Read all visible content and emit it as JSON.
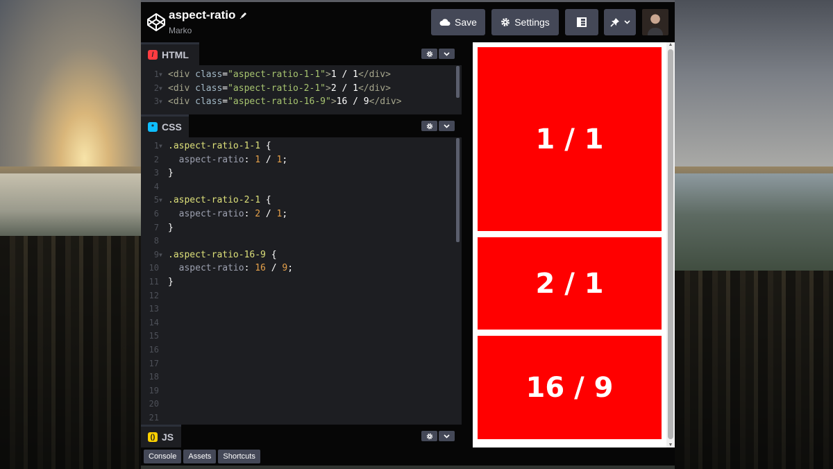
{
  "header": {
    "pen_title": "aspect-ratio",
    "author": "Marko",
    "save_label": "Save",
    "settings_label": "Settings"
  },
  "editors": {
    "html": {
      "label": "HTML",
      "lines": [
        {
          "n": "1",
          "parts": [
            [
              "t-tag",
              "<div "
            ],
            [
              "t-attr",
              "class"
            ],
            [
              "t-punc",
              "="
            ],
            [
              "t-str",
              "\"aspect-ratio-1-1\""
            ],
            [
              "t-tag",
              ">"
            ],
            [
              "t-plain",
              "1 / 1"
            ],
            [
              "t-tag",
              "</div>"
            ]
          ]
        },
        {
          "n": "2",
          "parts": [
            [
              "t-tag",
              "<div "
            ],
            [
              "t-attr",
              "class"
            ],
            [
              "t-punc",
              "="
            ],
            [
              "t-str",
              "\"aspect-ratio-2-1\""
            ],
            [
              "t-tag",
              ">"
            ],
            [
              "t-plain",
              "2 / 1"
            ],
            [
              "t-tag",
              "</div>"
            ]
          ]
        },
        {
          "n": "3",
          "parts": [
            [
              "t-tag",
              "<div "
            ],
            [
              "t-attr",
              "class"
            ],
            [
              "t-punc",
              "="
            ],
            [
              "t-str",
              "\"aspect-ratio-16-9\""
            ],
            [
              "t-tag",
              ">"
            ],
            [
              "t-plain",
              "16 / 9"
            ],
            [
              "t-tag",
              "</div>"
            ]
          ]
        }
      ]
    },
    "css": {
      "label": "CSS",
      "lines": [
        {
          "n": "1",
          "fold": true,
          "parts": [
            [
              "t-sel",
              ".aspect-ratio-1-1 "
            ],
            [
              "t-punc",
              "{"
            ]
          ]
        },
        {
          "n": "2",
          "parts": [
            [
              "t-prop",
              "  aspect-ratio"
            ],
            [
              "t-punc",
              ": "
            ],
            [
              "t-num",
              "1"
            ],
            [
              "t-punc",
              " / "
            ],
            [
              "t-num",
              "1"
            ],
            [
              "t-punc",
              ";"
            ]
          ]
        },
        {
          "n": "3",
          "parts": [
            [
              "t-punc",
              "}"
            ]
          ]
        },
        {
          "n": "4",
          "parts": []
        },
        {
          "n": "5",
          "fold": true,
          "parts": [
            [
              "t-sel",
              ".aspect-ratio-2-1 "
            ],
            [
              "t-punc",
              "{"
            ]
          ]
        },
        {
          "n": "6",
          "parts": [
            [
              "t-prop",
              "  aspect-ratio"
            ],
            [
              "t-punc",
              ": "
            ],
            [
              "t-num",
              "2"
            ],
            [
              "t-punc",
              " / "
            ],
            [
              "t-num",
              "1"
            ],
            [
              "t-punc",
              ";"
            ]
          ]
        },
        {
          "n": "7",
          "parts": [
            [
              "t-punc",
              "}"
            ]
          ]
        },
        {
          "n": "8",
          "parts": []
        },
        {
          "n": "9",
          "fold": true,
          "parts": [
            [
              "t-sel",
              ".aspect-ratio-16-9 "
            ],
            [
              "t-punc",
              "{"
            ]
          ]
        },
        {
          "n": "10",
          "parts": [
            [
              "t-prop",
              "  aspect-ratio"
            ],
            [
              "t-punc",
              ": "
            ],
            [
              "t-num",
              "16"
            ],
            [
              "t-punc",
              " / "
            ],
            [
              "t-num",
              "9"
            ],
            [
              "t-punc",
              ";"
            ]
          ]
        },
        {
          "n": "11",
          "parts": [
            [
              "t-punc",
              "}"
            ]
          ]
        },
        {
          "n": "12",
          "parts": []
        },
        {
          "n": "13",
          "parts": []
        },
        {
          "n": "14",
          "parts": []
        },
        {
          "n": "15",
          "parts": []
        },
        {
          "n": "16",
          "parts": []
        },
        {
          "n": "17",
          "parts": []
        },
        {
          "n": "18",
          "parts": []
        },
        {
          "n": "19",
          "parts": []
        },
        {
          "n": "20",
          "parts": []
        },
        {
          "n": "21",
          "parts": []
        }
      ]
    },
    "js": {
      "label": "JS"
    }
  },
  "preview": {
    "boxes": [
      "1 / 1",
      "2 / 1",
      "16 / 9"
    ],
    "box_color": "#ff0000"
  },
  "footer": {
    "buttons": [
      "Console",
      "Assets",
      "Shortcuts"
    ]
  },
  "icons": [
    "codepen-logo-icon",
    "pencil-icon",
    "cloud-icon",
    "gear-icon",
    "layout-icon",
    "pin-icon",
    "chevron-down-icon"
  ]
}
